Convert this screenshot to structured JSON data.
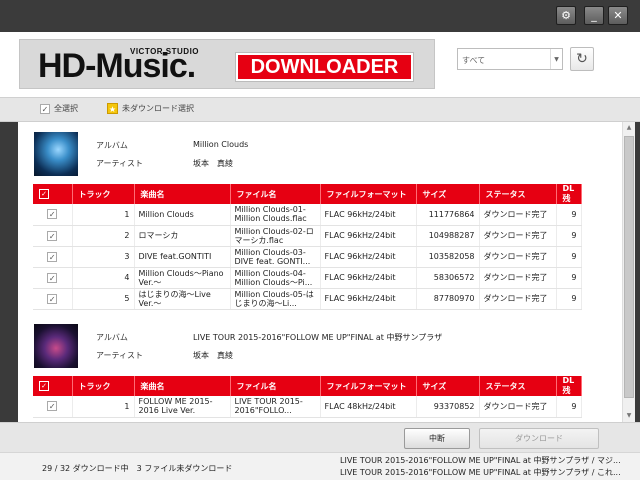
{
  "window": {
    "settings_icon": "gear-icon",
    "minimize_icon": "minimize-icon",
    "close_icon": "close-icon"
  },
  "header": {
    "logo_text": "HD-Music.",
    "logo_sub": "VICTOR STUDIO",
    "logo_badge": "DOWNLOADER",
    "filter_value": "すべて",
    "refresh_icon": "refresh-icon"
  },
  "toolbar": {
    "select_all": "全選択",
    "select_undownloaded": "未ダウンロード選択"
  },
  "columns": [
    "トラック",
    "楽曲名",
    "ファイル名",
    "ファイルフォーマット",
    "サイズ",
    "ステータス",
    "DL残"
  ],
  "albums": [
    {
      "album_label": "アルバム",
      "album_title": "Million Clouds",
      "artist_label": "アーティスト",
      "artist": "坂本　真綾",
      "tracks": [
        {
          "no": "1",
          "title": "Million Clouds",
          "file": "Million Clouds-01-Million Clouds.flac",
          "format": "FLAC 96kHz/24bit",
          "size": "111776864",
          "status": "ダウンロード完了",
          "dl": "9"
        },
        {
          "no": "2",
          "title": "ロマーシカ",
          "file": "Million Clouds-02-ロマーシカ.flac",
          "format": "FLAC 96kHz/24bit",
          "size": "104988287",
          "status": "ダウンロード完了",
          "dl": "9"
        },
        {
          "no": "3",
          "title": "DIVE feat.GONTITI",
          "file": "Million Clouds-03-DIVE feat. GONTI...",
          "format": "FLAC 96kHz/24bit",
          "size": "103582058",
          "status": "ダウンロード完了",
          "dl": "9"
        },
        {
          "no": "4",
          "title": "Million Clouds～Piano Ver.～",
          "file": "Million Clouds-04-Million Clouds～Pi...",
          "format": "FLAC 96kHz/24bit",
          "size": "58306572",
          "status": "ダウンロード完了",
          "dl": "9"
        },
        {
          "no": "5",
          "title": "はじまりの海～Live Ver.～",
          "file": "Million Clouds-05-はじまりの海～Li...",
          "format": "FLAC 96kHz/24bit",
          "size": "87780970",
          "status": "ダウンロード完了",
          "dl": "9"
        }
      ]
    },
    {
      "album_label": "アルバム",
      "album_title": "LIVE TOUR 2015-2016\"FOLLOW ME UP\"FINAL at 中野サンプラザ",
      "artist_label": "アーティスト",
      "artist": "坂本　真綾",
      "tracks": [
        {
          "no": "1",
          "title": "FOLLOW ME 2015-2016 Live Ver.",
          "file": "LIVE TOUR 2015-2016\"FOLLO...",
          "format": "FLAC 48kHz/24bit",
          "size": "93370852",
          "status": "ダウンロード完了",
          "dl": "9"
        }
      ]
    }
  ],
  "buttons": {
    "stop": "中断",
    "download": "ダウンロード"
  },
  "status": {
    "progress_text": "29 / 32 ダウンロード中　3 ファイル未ダウンロード",
    "log_1": "LIVE TOUR 2015-2016\"FOLLOW ME UP\"FINAL at 中野サンプラザ / マジ...",
    "log_2": "LIVE TOUR 2015-2016\"FOLLOW ME UP\"FINAL at 中野サンプラザ / これ..."
  },
  "colors": {
    "accent": "#e60012",
    "titlebar": "#3b3b3b"
  }
}
